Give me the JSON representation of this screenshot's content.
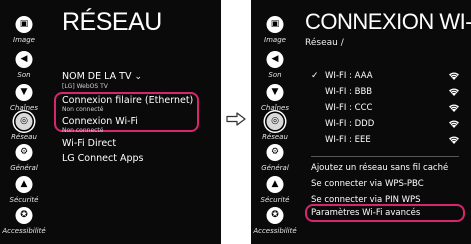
{
  "sidebar": {
    "items": [
      {
        "label": "Image",
        "icon": "image-icon",
        "glyph": "▣"
      },
      {
        "label": "Son",
        "icon": "sound-icon",
        "glyph": "◀"
      },
      {
        "label": "Chaînes",
        "icon": "channels-icon",
        "glyph": "▼"
      },
      {
        "label": "Réseau",
        "icon": "network-icon",
        "glyph": "◎"
      },
      {
        "label": "Général",
        "icon": "general-icon",
        "glyph": "⚙"
      },
      {
        "label": "Sécurité",
        "icon": "security-icon",
        "glyph": "▲"
      },
      {
        "label": "Accessibilité",
        "icon": "accessibility-icon",
        "glyph": "✪"
      }
    ]
  },
  "screen1": {
    "title": "RÉSEAU",
    "items": [
      {
        "label": "NOM DE LA TV",
        "sub": "[LG] WebOS TV"
      },
      {
        "label": "Connexion filaire (Ethernet)",
        "sub": "Non connecté"
      },
      {
        "label": "Connexion Wi-Fi",
        "sub": "Non connecté"
      },
      {
        "label": "Wi-Fi Direct",
        "sub": ""
      },
      {
        "label": "LG Connect Apps",
        "sub": ""
      }
    ]
  },
  "arrow_glyph": "⇨",
  "screen2": {
    "title": "CONNEXION WI-FI",
    "breadcrumb": "Réseau /",
    "networks": [
      {
        "name": "WI-FI : AAA",
        "selected": true
      },
      {
        "name": "WI-FI : BBB",
        "selected": false
      },
      {
        "name": "WI-FI : CCC",
        "selected": false
      },
      {
        "name": "WI-FI : DDD",
        "selected": false
      },
      {
        "name": "WI-FI : EEE",
        "selected": false
      }
    ],
    "actions": [
      "Ajoutez un réseau sans fil caché",
      "Se connecter via WPS-PBC",
      "Se connecter via PIN WPS",
      "Paramètres Wi-Fi avancés"
    ]
  },
  "colors": {
    "highlight": "#d9246e",
    "background": "#0a0a0a",
    "text": "#ffffff"
  }
}
